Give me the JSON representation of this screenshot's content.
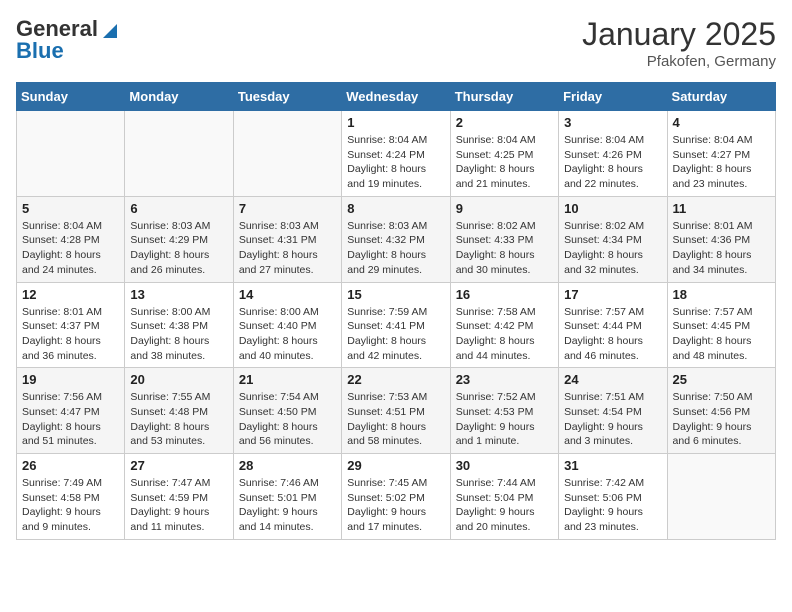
{
  "logo": {
    "line1": "General",
    "line2": "Blue"
  },
  "header": {
    "month": "January 2025",
    "location": "Pfakofen, Germany"
  },
  "weekdays": [
    "Sunday",
    "Monday",
    "Tuesday",
    "Wednesday",
    "Thursday",
    "Friday",
    "Saturday"
  ],
  "weeks": [
    [
      {
        "day": "",
        "info": ""
      },
      {
        "day": "",
        "info": ""
      },
      {
        "day": "",
        "info": ""
      },
      {
        "day": "1",
        "info": "Sunrise: 8:04 AM\nSunset: 4:24 PM\nDaylight: 8 hours\nand 19 minutes."
      },
      {
        "day": "2",
        "info": "Sunrise: 8:04 AM\nSunset: 4:25 PM\nDaylight: 8 hours\nand 21 minutes."
      },
      {
        "day": "3",
        "info": "Sunrise: 8:04 AM\nSunset: 4:26 PM\nDaylight: 8 hours\nand 22 minutes."
      },
      {
        "day": "4",
        "info": "Sunrise: 8:04 AM\nSunset: 4:27 PM\nDaylight: 8 hours\nand 23 minutes."
      }
    ],
    [
      {
        "day": "5",
        "info": "Sunrise: 8:04 AM\nSunset: 4:28 PM\nDaylight: 8 hours\nand 24 minutes."
      },
      {
        "day": "6",
        "info": "Sunrise: 8:03 AM\nSunset: 4:29 PM\nDaylight: 8 hours\nand 26 minutes."
      },
      {
        "day": "7",
        "info": "Sunrise: 8:03 AM\nSunset: 4:31 PM\nDaylight: 8 hours\nand 27 minutes."
      },
      {
        "day": "8",
        "info": "Sunrise: 8:03 AM\nSunset: 4:32 PM\nDaylight: 8 hours\nand 29 minutes."
      },
      {
        "day": "9",
        "info": "Sunrise: 8:02 AM\nSunset: 4:33 PM\nDaylight: 8 hours\nand 30 minutes."
      },
      {
        "day": "10",
        "info": "Sunrise: 8:02 AM\nSunset: 4:34 PM\nDaylight: 8 hours\nand 32 minutes."
      },
      {
        "day": "11",
        "info": "Sunrise: 8:01 AM\nSunset: 4:36 PM\nDaylight: 8 hours\nand 34 minutes."
      }
    ],
    [
      {
        "day": "12",
        "info": "Sunrise: 8:01 AM\nSunset: 4:37 PM\nDaylight: 8 hours\nand 36 minutes."
      },
      {
        "day": "13",
        "info": "Sunrise: 8:00 AM\nSunset: 4:38 PM\nDaylight: 8 hours\nand 38 minutes."
      },
      {
        "day": "14",
        "info": "Sunrise: 8:00 AM\nSunset: 4:40 PM\nDaylight: 8 hours\nand 40 minutes."
      },
      {
        "day": "15",
        "info": "Sunrise: 7:59 AM\nSunset: 4:41 PM\nDaylight: 8 hours\nand 42 minutes."
      },
      {
        "day": "16",
        "info": "Sunrise: 7:58 AM\nSunset: 4:42 PM\nDaylight: 8 hours\nand 44 minutes."
      },
      {
        "day": "17",
        "info": "Sunrise: 7:57 AM\nSunset: 4:44 PM\nDaylight: 8 hours\nand 46 minutes."
      },
      {
        "day": "18",
        "info": "Sunrise: 7:57 AM\nSunset: 4:45 PM\nDaylight: 8 hours\nand 48 minutes."
      }
    ],
    [
      {
        "day": "19",
        "info": "Sunrise: 7:56 AM\nSunset: 4:47 PM\nDaylight: 8 hours\nand 51 minutes."
      },
      {
        "day": "20",
        "info": "Sunrise: 7:55 AM\nSunset: 4:48 PM\nDaylight: 8 hours\nand 53 minutes."
      },
      {
        "day": "21",
        "info": "Sunrise: 7:54 AM\nSunset: 4:50 PM\nDaylight: 8 hours\nand 56 minutes."
      },
      {
        "day": "22",
        "info": "Sunrise: 7:53 AM\nSunset: 4:51 PM\nDaylight: 8 hours\nand 58 minutes."
      },
      {
        "day": "23",
        "info": "Sunrise: 7:52 AM\nSunset: 4:53 PM\nDaylight: 9 hours\nand 1 minute."
      },
      {
        "day": "24",
        "info": "Sunrise: 7:51 AM\nSunset: 4:54 PM\nDaylight: 9 hours\nand 3 minutes."
      },
      {
        "day": "25",
        "info": "Sunrise: 7:50 AM\nSunset: 4:56 PM\nDaylight: 9 hours\nand 6 minutes."
      }
    ],
    [
      {
        "day": "26",
        "info": "Sunrise: 7:49 AM\nSunset: 4:58 PM\nDaylight: 9 hours\nand 9 minutes."
      },
      {
        "day": "27",
        "info": "Sunrise: 7:47 AM\nSunset: 4:59 PM\nDaylight: 9 hours\nand 11 minutes."
      },
      {
        "day": "28",
        "info": "Sunrise: 7:46 AM\nSunset: 5:01 PM\nDaylight: 9 hours\nand 14 minutes."
      },
      {
        "day": "29",
        "info": "Sunrise: 7:45 AM\nSunset: 5:02 PM\nDaylight: 9 hours\nand 17 minutes."
      },
      {
        "day": "30",
        "info": "Sunrise: 7:44 AM\nSunset: 5:04 PM\nDaylight: 9 hours\nand 20 minutes."
      },
      {
        "day": "31",
        "info": "Sunrise: 7:42 AM\nSunset: 5:06 PM\nDaylight: 9 hours\nand 23 minutes."
      },
      {
        "day": "",
        "info": ""
      }
    ]
  ]
}
